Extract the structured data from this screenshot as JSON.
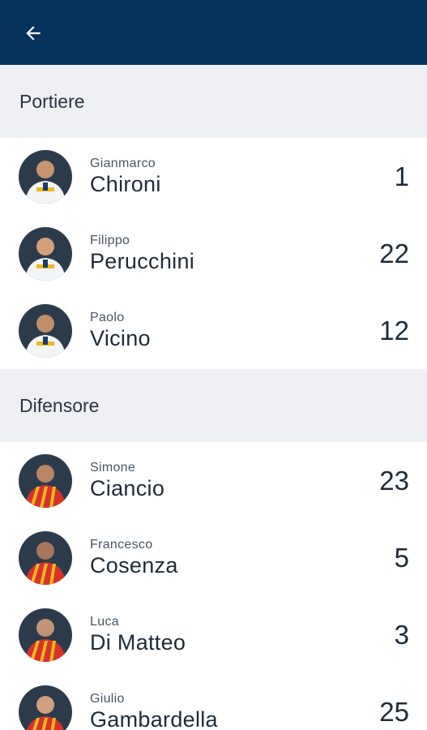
{
  "header": {
    "back_icon": "arrow-left-icon",
    "background": "#05335c"
  },
  "sections": [
    {
      "title": "Portiere",
      "players": [
        {
          "first_name": "Gianmarco",
          "last_name": "Chironi",
          "number": "1",
          "kit": "away"
        },
        {
          "first_name": "Filippo",
          "last_name": "Perucchini",
          "number": "22",
          "kit": "away"
        },
        {
          "first_name": "Paolo",
          "last_name": "Vicino",
          "number": "12",
          "kit": "away"
        }
      ]
    },
    {
      "title": "Difensore",
      "players": [
        {
          "first_name": "Simone",
          "last_name": "Ciancio",
          "number": "23",
          "kit": "home"
        },
        {
          "first_name": "Francesco",
          "last_name": "Cosenza",
          "number": "5",
          "kit": "home"
        },
        {
          "first_name": "Luca",
          "last_name": "Di Matteo",
          "number": "3",
          "kit": "home"
        },
        {
          "first_name": "Giulio",
          "last_name": "Gambardella",
          "number": "25",
          "kit": "home"
        }
      ]
    }
  ],
  "colors": {
    "section_bg": "#eef0f3",
    "kit_home_red": "#d8322b",
    "kit_home_yellow": "#f2b71f",
    "kit_away": "#f3f4f6"
  }
}
